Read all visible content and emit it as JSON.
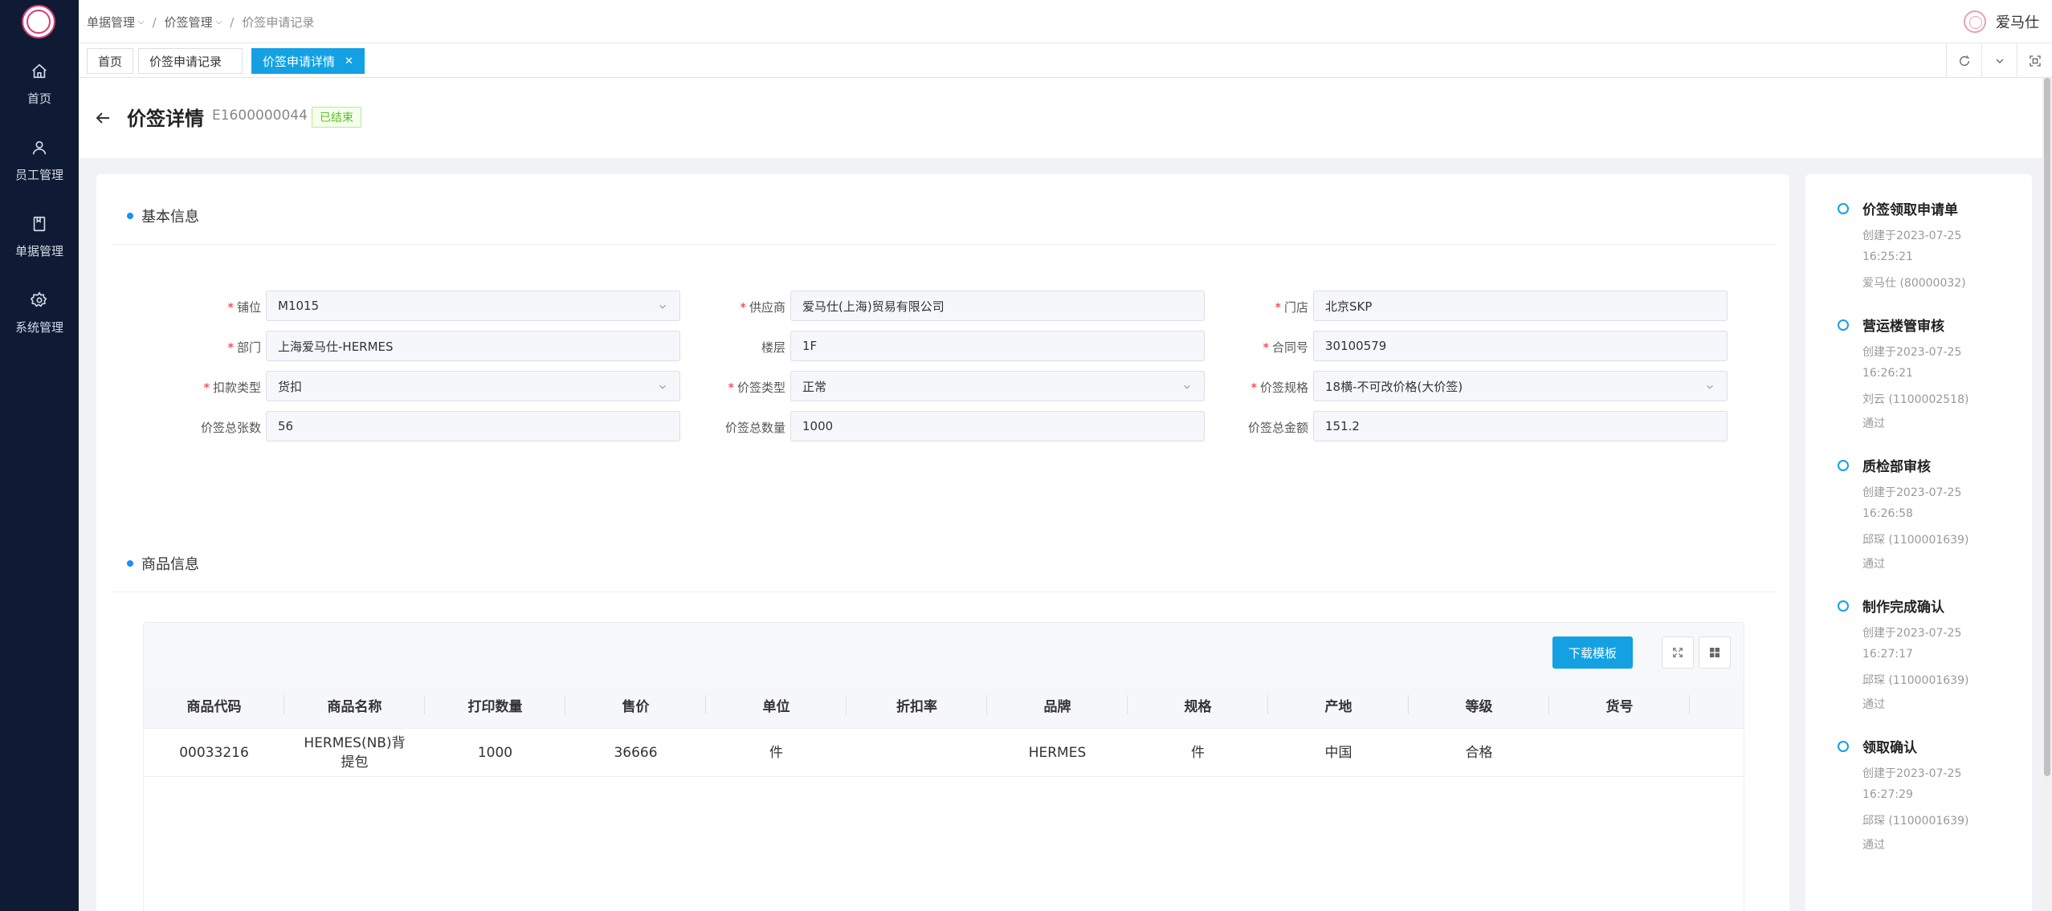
{
  "sidebar": {
    "items": [
      {
        "label": "首页",
        "icon": "home-icon"
      },
      {
        "label": "员工管理",
        "icon": "user-icon"
      },
      {
        "label": "单据管理",
        "icon": "document-icon"
      },
      {
        "label": "系统管理",
        "icon": "gear-icon"
      }
    ]
  },
  "header": {
    "breadcrumb": [
      "单据管理",
      "价签管理",
      "价签申请记录"
    ],
    "user_name": "爱马仕"
  },
  "tabs": [
    {
      "label": "首页"
    },
    {
      "label": "价签申请记录"
    },
    {
      "label": "价签申请详情",
      "active": true
    }
  ],
  "page": {
    "title": "价签详情",
    "code": "E1600000044",
    "status": "已结束"
  },
  "basic_info": {
    "title": "基本信息",
    "fields": [
      {
        "label": "铺位",
        "value": "M1015",
        "required": true,
        "select": true
      },
      {
        "label": "供应商",
        "value": "爱马仕(上海)贸易有限公司",
        "required": true,
        "select": false
      },
      {
        "label": "门店",
        "value": "北京SKP",
        "required": true,
        "select": false
      },
      {
        "label": "部门",
        "value": "上海爱马仕-HERMES",
        "required": true,
        "select": false
      },
      {
        "label": "楼层",
        "value": "1F",
        "required": false,
        "select": false
      },
      {
        "label": "合同号",
        "value": "30100579",
        "required": true,
        "select": false
      },
      {
        "label": "扣款类型",
        "value": "货扣",
        "required": true,
        "select": true
      },
      {
        "label": "价签类型",
        "value": "正常",
        "required": true,
        "select": true
      },
      {
        "label": "价签规格",
        "value": "18横-不可改价格(大价签)",
        "required": true,
        "select": true
      },
      {
        "label": "价签总张数",
        "value": "56",
        "required": false,
        "select": false
      },
      {
        "label": "价签总数量",
        "value": "1000",
        "required": false,
        "select": false
      },
      {
        "label": "价签总金额",
        "value": "151.2",
        "required": false,
        "select": false
      }
    ]
  },
  "goods_info": {
    "title": "商品信息",
    "download_label": "下载模板",
    "columns": [
      "商品代码",
      "商品名称",
      "打印数量",
      "售价",
      "单位",
      "折扣率",
      "品牌",
      "规格",
      "产地",
      "等级",
      "货号"
    ],
    "rows": [
      [
        "00033216",
        "HERMES(NB)背提包",
        "1000",
        "36666",
        "件",
        "",
        "HERMES",
        "件",
        "中国",
        "合格",
        ""
      ]
    ]
  },
  "timeline": [
    {
      "title": "价签领取申请单",
      "lines": [
        "创建于2023-07-25",
        "16:25:21",
        "爱马仕 (80000032)"
      ]
    },
    {
      "title": "营运楼管审核",
      "lines": [
        "创建于2023-07-25",
        "16:26:21",
        "刘云 (1100002518)",
        "通过"
      ]
    },
    {
      "title": "质检部审核",
      "lines": [
        "创建于2023-07-25",
        "16:26:58",
        "邱琛 (1100001639)",
        "通过"
      ]
    },
    {
      "title": "制作完成确认",
      "lines": [
        "创建于2023-07-25",
        "16:27:17",
        "邱琛 (1100001639)",
        "通过"
      ]
    },
    {
      "title": "领取确认",
      "lines": [
        "创建于2023-07-25",
        "16:27:29",
        "邱琛 (1100001639)",
        "通过"
      ]
    }
  ],
  "colors": {
    "accent": "#13a1e4",
    "sidebar_bg": "#0f1b35",
    "required": "#f5222d",
    "success": "#52c41a"
  }
}
